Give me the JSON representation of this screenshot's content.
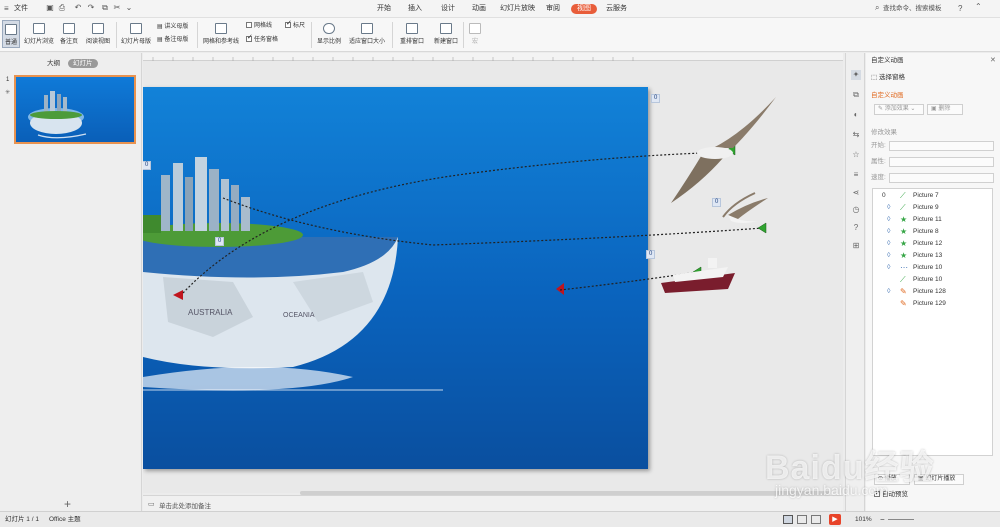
{
  "menubar": {
    "file_label": "文件",
    "tabs": [
      "开始",
      "插入",
      "设计",
      "动画",
      "幻灯片放映",
      "审阅",
      "视图",
      "云服务"
    ],
    "active_tab": "视图",
    "search_placeholder": "查找命令、搜索模板",
    "help_label": "?"
  },
  "ribbon": {
    "normal_label": "普通",
    "slide_sorter_label": "幻灯片浏览",
    "notes_page_label": "备注页",
    "reading_view_label": "阅读视图",
    "slide_master_label": "幻灯片母版",
    "handout_master_label": "讲义母版",
    "notes_master_label": "备注母版",
    "gridlines_label": "网格线",
    "ruler_label": "标尺",
    "grid_guides_label": "网格和参考线",
    "taskpane_label": "任务窗格",
    "zoom_label": "显示比例",
    "fit_window_label": "适应窗口大小",
    "arrange_label": "重排窗口",
    "new_window_label": "新建窗口",
    "macro_label": "宏"
  },
  "leftpanel": {
    "tab_outline": "大纲",
    "tab_slides": "幻灯片",
    "slide_number": "1",
    "add_slide": "+"
  },
  "slide": {
    "tags": [
      "0",
      "0",
      "0",
      "0",
      "0"
    ],
    "map_text_1": "AUSTRALIA",
    "map_text_2": "OCEANIA"
  },
  "notes": {
    "placeholder": "单击此处添加备注"
  },
  "rightpanel": {
    "title": "自定义动画",
    "select_pane": "选择窗格",
    "section_title": "自定义动画",
    "add_effect": "添加效果",
    "delete": "删除",
    "modify_title": "修改效果",
    "start_label": "开始:",
    "property_label": "属性:",
    "speed_label": "速度:",
    "list_index": "0",
    "effects": [
      "Picture 7",
      "Picture 9",
      "Picture 11",
      "Picture 8",
      "Picture 12",
      "Picture 13",
      "Picture 10",
      "Picture 10",
      "Picture 128",
      "Picture 129"
    ],
    "play_button": "播放",
    "slideshow_button": "幻灯片播放",
    "autopreview": "自动预览"
  },
  "statusbar": {
    "slide_info": "幻灯片 1 / 1",
    "theme": "Office 主题",
    "zoom": "101%"
  },
  "watermark": {
    "text": "Baidu经验",
    "url": "jingyan.baidu.com"
  }
}
